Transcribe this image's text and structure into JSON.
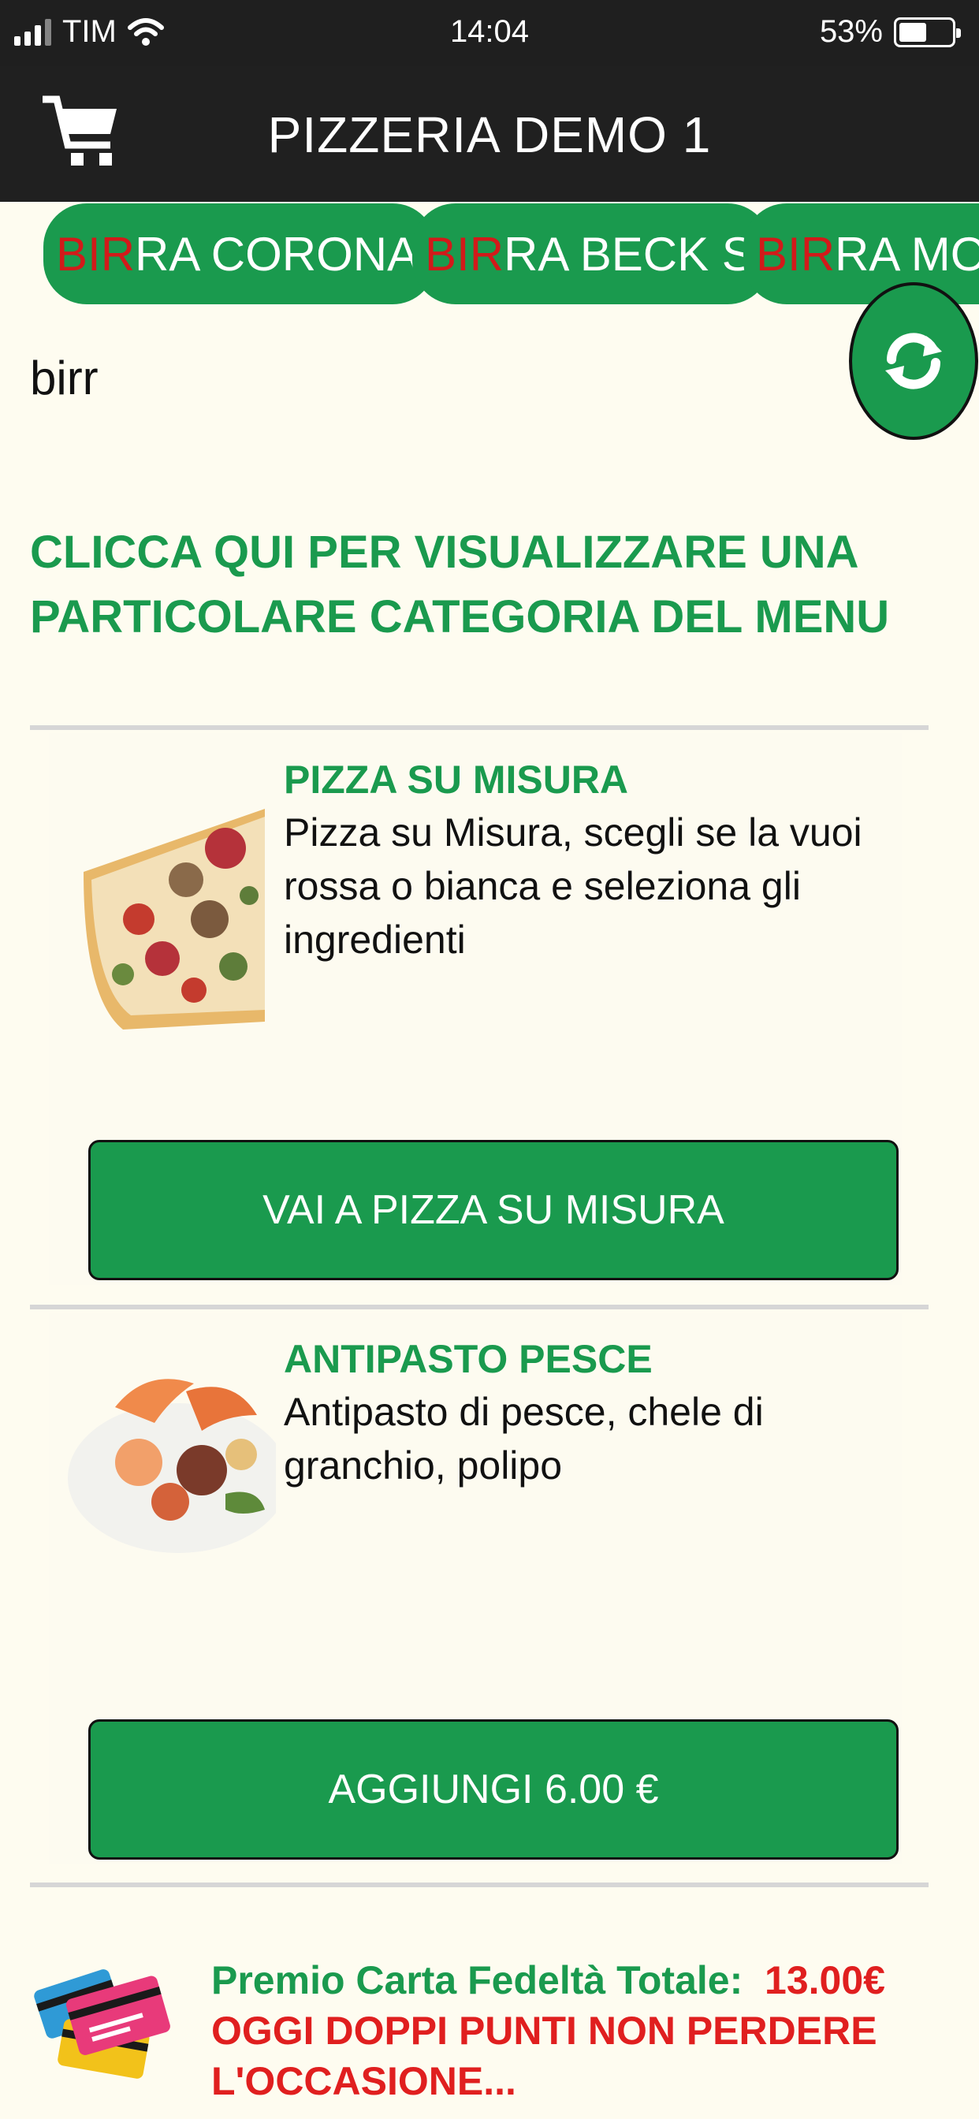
{
  "status": {
    "carrier": "TIM",
    "time": "14:04",
    "battery": "53%",
    "battery_level": 0.53
  },
  "header": {
    "title": "PIZZERIA DEMO 1",
    "cart_icon": "cart-icon"
  },
  "chips": [
    {
      "highlight": "BIR",
      "rest": "RA CORONA"
    },
    {
      "highlight": "BIR",
      "rest": "RA BECK S"
    },
    {
      "highlight": "BIR",
      "rest": "RA MOR"
    }
  ],
  "search": {
    "query": "birr"
  },
  "category_link": "CLICCA QUI PER VISUALIZZARE UNA PARTICOLARE CATEGORIA DEL MENU",
  "products": [
    {
      "name": "PIZZA SU MISURA",
      "description": "Pizza su Misura, scegli se la vuoi rossa o bianca e seleziona gli ingredienti",
      "button": "VAI A PIZZA SU MISURA"
    },
    {
      "name": "ANTIPASTO PESCE",
      "description": "Antipasto di pesce, chele di granchio, polipo",
      "button": "AGGIUNGI 6.00 €"
    }
  ],
  "loyalty": {
    "label": "Premio Carta Fedeltà Totale:",
    "value": "13.00€",
    "promo_line1": "OGGI DOPPI PUNTI NON PERDERE",
    "promo_line2": "L'OCCASIONE..."
  },
  "colors": {
    "accent": "#1a9a4e",
    "highlight_red": "#d21a1a",
    "header": "#202020",
    "background": "#fefcf0"
  }
}
